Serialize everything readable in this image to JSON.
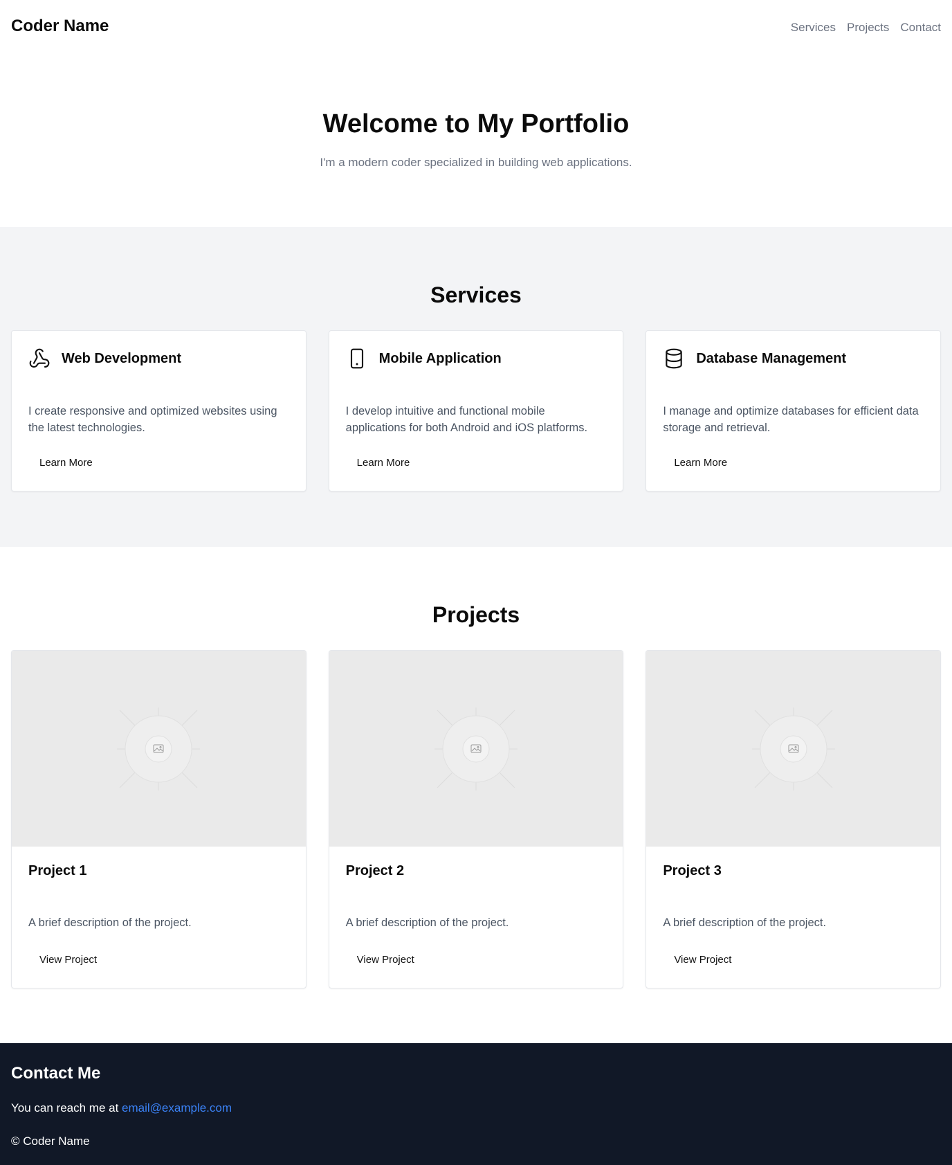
{
  "header": {
    "brand": "Coder Name",
    "nav": [
      "Services",
      "Projects",
      "Contact"
    ]
  },
  "hero": {
    "title": "Welcome to My Portfolio",
    "subtitle": "I'm a modern coder specialized in building web applications."
  },
  "services": {
    "title": "Services",
    "items": [
      {
        "icon": "webhook-icon",
        "title": "Web Development",
        "description": "I create responsive and optimized websites using the latest technologies.",
        "button": "Learn More"
      },
      {
        "icon": "smartphone-icon",
        "title": "Mobile Application",
        "description": "I develop intuitive and functional mobile applications for both Android and iOS platforms.",
        "button": "Learn More"
      },
      {
        "icon": "database-icon",
        "title": "Database Management",
        "description": "I manage and optimize databases for efficient data storage and retrieval.",
        "button": "Learn More"
      }
    ]
  },
  "projects": {
    "title": "Projects",
    "items": [
      {
        "image_icon": "image-placeholder-icon",
        "title": "Project 1",
        "description": "A brief description of the project.",
        "button": "View Project"
      },
      {
        "image_icon": "image-placeholder-icon",
        "title": "Project 2",
        "description": "A brief description of the project.",
        "button": "View Project"
      },
      {
        "image_icon": "image-placeholder-icon",
        "title": "Project 3",
        "description": "A brief description of the project.",
        "button": "View Project"
      }
    ]
  },
  "footer": {
    "title": "Contact Me",
    "reach_prefix": "You can reach me at",
    "email": "email@example.com",
    "copyright": "© Coder Name"
  },
  "colors": {
    "section_bg": "#f3f4f6",
    "footer_bg": "#111827",
    "link": "#3b82f6",
    "muted_text": "#6b7280"
  }
}
